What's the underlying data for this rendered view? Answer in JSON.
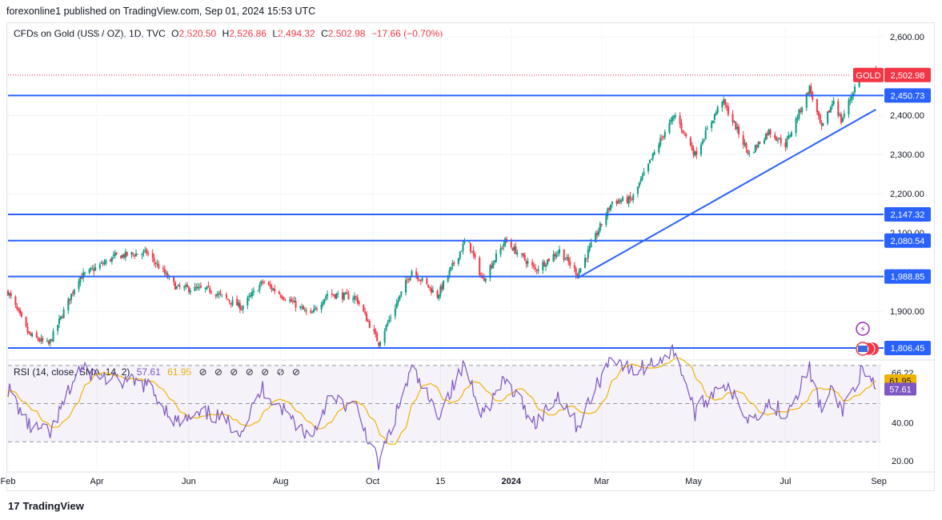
{
  "publisher": "forexonline1 published on TradingView.com, Sep 01, 2024 15:53 UTC",
  "legend": {
    "symbol": "CFDs on Gold (US$ / OZ), 1D, TVC",
    "open_label": "O",
    "open": "2,520.50",
    "high_label": "H",
    "high": "2,526.86",
    "low_label": "L",
    "low": "2,494.32",
    "close_label": "C",
    "close": "2,502.98",
    "change": "−17.66 (−0.70%)"
  },
  "rsi_legend": {
    "label": "RSI (14, close, SMA, 14, 2)",
    "rsi": "57.61",
    "sma": "61.95",
    "icons": [
      "eye-icon",
      "eye-icon",
      "eye-icon",
      "eye-icon",
      "eye-icon",
      "eye-icon",
      "eye-icon"
    ],
    "icon_glyph": "⊘"
  },
  "brand": {
    "logo": "17",
    "text": "TradingView"
  },
  "colors": {
    "up": "#089981",
    "down": "#f23645",
    "level": "#2962ff",
    "rsi": "#7e57c2",
    "sma": "#f0b400",
    "band": "#7e57c2"
  },
  "chart_data": {
    "type": "candlestick",
    "title": "CFDs on Gold (US$ / OZ), 1D, TVC",
    "ylim": [
      1780,
      2625
    ],
    "y_ticks": [
      "2,600.00",
      "2,500.00",
      "2,400.00",
      "2,300.00",
      "2,200.00",
      "2,100.00",
      "2,000.00",
      "1,900.00"
    ],
    "x_ticks": [
      "Feb",
      "Apr",
      "Jun",
      "Aug",
      "Oct",
      "15",
      "2024",
      "Mar",
      "May",
      "Jul",
      "Sep"
    ],
    "price_path": [
      [
        "2023-02-01",
        1950
      ],
      [
        "2023-02-15",
        1840
      ],
      [
        "2023-02-28",
        1815
      ],
      [
        "2023-03-20",
        1985
      ],
      [
        "2023-04-13",
        2040
      ],
      [
        "2023-05-04",
        2050
      ],
      [
        "2023-05-24",
        1960
      ],
      [
        "2023-06-15",
        1955
      ],
      [
        "2023-07-06",
        1910
      ],
      [
        "2023-07-20",
        1975
      ],
      [
        "2023-08-21",
        1890
      ],
      [
        "2023-09-01",
        1945
      ],
      [
        "2023-09-20",
        1935
      ],
      [
        "2023-10-05",
        1820
      ],
      [
        "2023-10-27",
        2005
      ],
      [
        "2023-11-13",
        1940
      ],
      [
        "2023-12-01",
        2075
      ],
      [
        "2023-12-04",
        2070
      ],
      [
        "2023-12-13",
        1980
      ],
      [
        "2023-12-28",
        2080
      ],
      [
        "2024-01-17",
        2006
      ],
      [
        "2024-02-02",
        2055
      ],
      [
        "2024-02-14",
        1995
      ],
      [
        "2024-03-08",
        2180
      ],
      [
        "2024-03-21",
        2185
      ],
      [
        "2024-04-12",
        2360
      ],
      [
        "2024-04-19",
        2400
      ],
      [
        "2024-05-02",
        2300
      ],
      [
        "2024-05-20",
        2440
      ],
      [
        "2024-06-07",
        2300
      ],
      [
        "2024-06-20",
        2360
      ],
      [
        "2024-07-01",
        2325
      ],
      [
        "2024-07-17",
        2470
      ],
      [
        "2024-07-25",
        2365
      ],
      [
        "2024-08-02",
        2440
      ],
      [
        "2024-08-07",
        2385
      ],
      [
        "2024-08-20",
        2510
      ],
      [
        "2024-08-30",
        2503
      ]
    ],
    "levels": [
      {
        "value": 2450.73,
        "label": "2,450.73"
      },
      {
        "value": 2147.32,
        "label": "2,147.32"
      },
      {
        "value": 2080.54,
        "label": "2,080.54"
      },
      {
        "value": 1988.85,
        "label": "1,988.85"
      },
      {
        "value": 1806.45,
        "label": "1,806.45"
      }
    ],
    "trendline": {
      "from": [
        "2024-02-14",
        1985
      ],
      "to": [
        "2024-08-30",
        2415
      ]
    },
    "last": {
      "label": "GOLD",
      "value": 2502.98,
      "text": "2,502.98"
    },
    "rsi": {
      "ylim": [
        15,
        72
      ],
      "ticks": [
        "66.22",
        "58.11",
        "40.00",
        "20.00"
      ],
      "bands": [
        70,
        50,
        30
      ],
      "value": 57.61,
      "value_text": "57.61",
      "sma": 61.95,
      "sma_text": "61.95",
      "path": [
        [
          "2023-02-01",
          58
        ],
        [
          "2023-02-15",
          38
        ],
        [
          "2023-03-01",
          34
        ],
        [
          "2023-03-20",
          68
        ],
        [
          "2023-04-13",
          62
        ],
        [
          "2023-05-04",
          60
        ],
        [
          "2023-05-24",
          40
        ],
        [
          "2023-06-15",
          45
        ],
        [
          "2023-07-06",
          36
        ],
        [
          "2023-07-20",
          58
        ],
        [
          "2023-08-21",
          32
        ],
        [
          "2023-09-01",
          52
        ],
        [
          "2023-09-20",
          48
        ],
        [
          "2023-10-05",
          18
        ],
        [
          "2023-10-27",
          68
        ],
        [
          "2023-11-13",
          44
        ],
        [
          "2023-12-01",
          70
        ],
        [
          "2023-12-13",
          45
        ],
        [
          "2023-12-28",
          62
        ],
        [
          "2024-01-17",
          40
        ],
        [
          "2024-02-02",
          55
        ],
        [
          "2024-02-14",
          38
        ],
        [
          "2024-03-08",
          76
        ],
        [
          "2024-03-21",
          66
        ],
        [
          "2024-04-12",
          75
        ],
        [
          "2024-04-19",
          78
        ],
        [
          "2024-05-02",
          45
        ],
        [
          "2024-05-20",
          62
        ],
        [
          "2024-06-07",
          42
        ],
        [
          "2024-06-20",
          50
        ],
        [
          "2024-07-01",
          45
        ],
        [
          "2024-07-17",
          68
        ],
        [
          "2024-07-25",
          46
        ],
        [
          "2024-08-02",
          58
        ],
        [
          "2024-08-07",
          46
        ],
        [
          "2024-08-20",
          66
        ],
        [
          "2024-08-30",
          57.61
        ]
      ]
    }
  }
}
